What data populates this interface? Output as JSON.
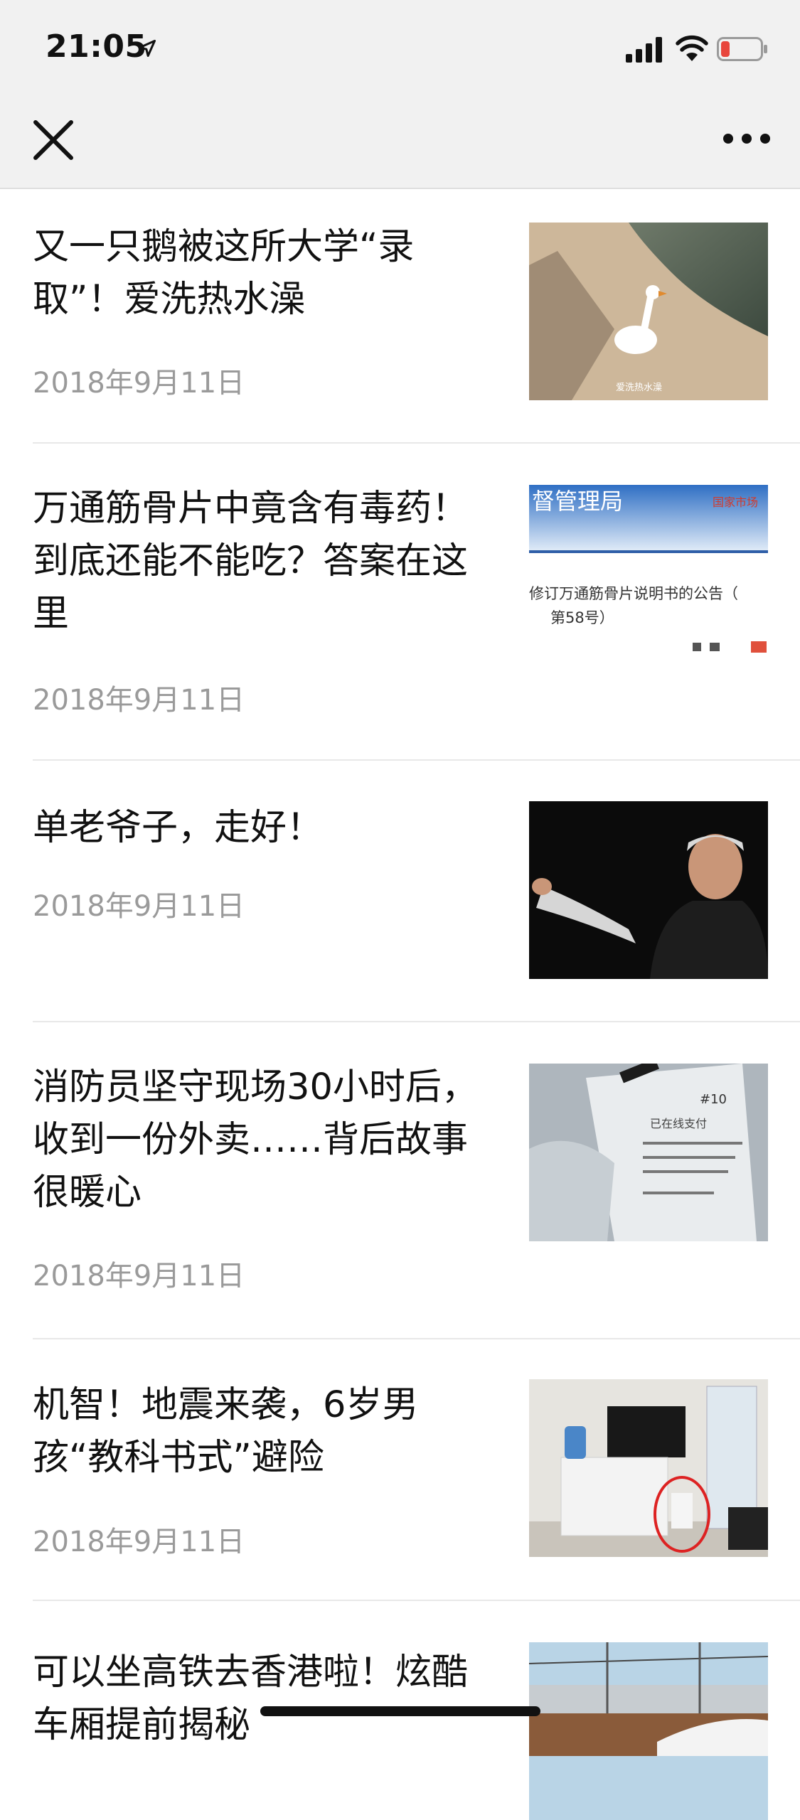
{
  "status_bar": {
    "time": "21:05",
    "icons": [
      "location-arrow-icon",
      "signal-icon",
      "wifi-icon",
      "battery-low-icon"
    ],
    "battery_color": "#e8453c"
  },
  "nav": {
    "close_icon": "close-icon",
    "more_icon": "more-icon"
  },
  "articles": [
    {
      "title": "又一只鹅被这所大学“录取”！爱洗热水澡",
      "date": "2018年9月11日",
      "thumb_caption": "爱洗热水澡"
    },
    {
      "title": "万通筋骨片中竟含有毒药！到底还能不能吃？答案在这里",
      "date": "2018年9月11日",
      "thumb_texts": [
        "督管理局",
        "国家市场",
        "修订万通筋骨片说明书的公告（",
        "第58号）"
      ]
    },
    {
      "title": "单老爷子，走好！",
      "date": "2018年9月11日"
    },
    {
      "title": "消防员坚守现场30小时后，收到一份外卖……背后故事很暖心",
      "date": "2018年9月11日",
      "thumb_texts": [
        "#10",
        "已在线支付"
      ]
    },
    {
      "title": "机智！地震来袭，6岁男孩“教科书式”避险",
      "date": "2018年9月11日"
    },
    {
      "title": "可以坐高铁去香港啦！炫酷车厢提前揭秘"
    }
  ]
}
